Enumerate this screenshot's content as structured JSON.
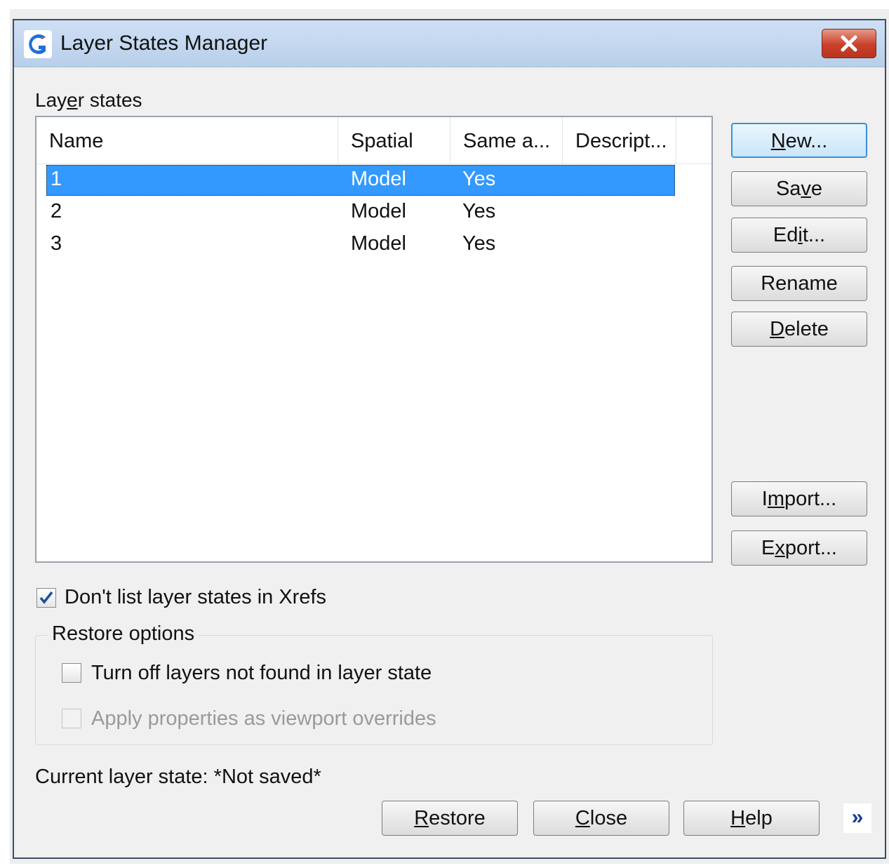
{
  "window": {
    "title": "Layer States Manager",
    "icon": "app-logo-icon",
    "close_icon": "close-icon"
  },
  "layer_states": {
    "label": "Layer states",
    "columns": [
      "Name",
      "Spatial",
      "Same a...",
      "Descript..."
    ],
    "rows": [
      {
        "name": "1",
        "spatial": "Model",
        "same": "Yes",
        "description": ""
      },
      {
        "name": "2",
        "spatial": "Model",
        "same": "Yes",
        "description": ""
      },
      {
        "name": "3",
        "spatial": "Model",
        "same": "Yes",
        "description": ""
      }
    ],
    "selected_row": 0
  },
  "buttons": {
    "new": "New...",
    "save": "Save",
    "edit": "Edit...",
    "rename": "Rename",
    "delete": "Delete",
    "import": "Import...",
    "export": "Export..."
  },
  "options": {
    "dont_list_xrefs": {
      "label": "Don't list layer states in Xrefs",
      "checked": true
    },
    "restore_options_title": "Restore options",
    "turn_off_layers": {
      "label": "Turn off layers not found in layer state",
      "checked": false
    },
    "apply_viewport": {
      "label": "Apply properties as viewport overrides",
      "checked": false,
      "disabled": true
    }
  },
  "status": {
    "current_state": "Current layer state: *Not saved*"
  },
  "footer": {
    "restore": "Restore",
    "close": "Close",
    "help": "Help",
    "expand": "»"
  },
  "colors": {
    "selection": "#3399ff",
    "titlebar": "#c4d8f0",
    "close_button": "#c9402a"
  }
}
